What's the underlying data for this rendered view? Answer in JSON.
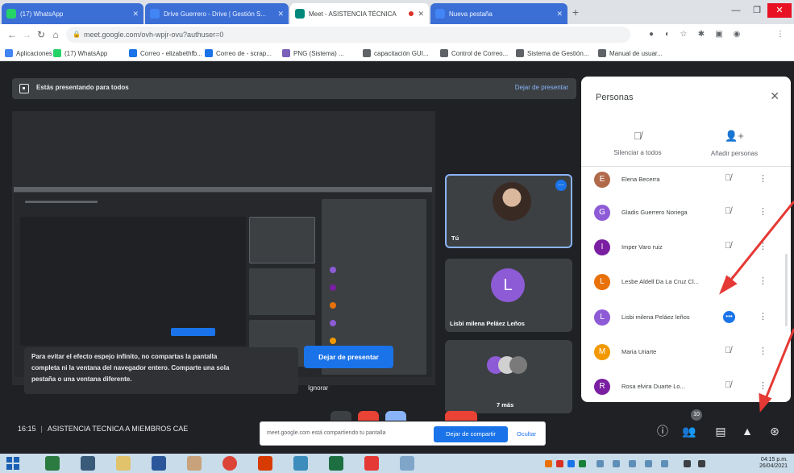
{
  "browser": {
    "tabs": [
      {
        "title": "(17) WhatsApp",
        "active": false,
        "color": "#25d366"
      },
      {
        "title": "Drive Guerrero - Drive | Gestión S...",
        "active": false,
        "color": "#4285f4"
      },
      {
        "title": "Meet - ASISTENCIA TÉCNICA",
        "active": true,
        "color": "#00897b"
      },
      {
        "title": "Nueva pestaña",
        "active": false,
        "color": "#4285f4"
      }
    ],
    "url": "meet.google.com/ovh-wpjr-ovu?authuser=0",
    "bookmarks": [
      {
        "label": "Aplicaciones",
        "color": "#4285f4"
      },
      {
        "label": "(17) WhatsApp",
        "color": "#25d366"
      },
      {
        "label": "Correo - elizabethfb...",
        "color": "#1a73e8"
      },
      {
        "label": "Correo de - scrap...",
        "color": "#1a73e8"
      },
      {
        "label": "PNG (Sistema) ...",
        "color": "#7b5fb8"
      },
      {
        "label": "capacitación GUI...",
        "color": "#5f6368"
      },
      {
        "label": "Control de Correo...",
        "color": "#5f6368"
      },
      {
        "label": "Sistema de Gestión...",
        "color": "#5f6368"
      },
      {
        "label": "Manual de usuar...",
        "color": "#5f6368"
      }
    ]
  },
  "presentation": {
    "banner_text": "Estás presentando para todos",
    "stop_link": "Dejar de presentar",
    "warning_lines": [
      "Para evitar el efecto espejo infinito, no compartas la pantalla",
      "completa ni la ventana del navegador entero. Comparte una sola",
      "pestaña o una ventana diferente."
    ],
    "stop_button": "Dejar de presentar",
    "ignore_button": "Ignorar"
  },
  "tiles": [
    {
      "label": "Tú",
      "kind": "photo"
    },
    {
      "label": "Lisbi milena Peláez Leños",
      "kind": "letter",
      "letter": "L",
      "color": "#8e5bd6"
    },
    {
      "label": "7 más",
      "kind": "group"
    }
  ],
  "people_panel": {
    "title": "Personas",
    "actions": [
      {
        "label": "Silenciar a todos",
        "icon": "mic-off-icon"
      },
      {
        "label": "Añadir personas",
        "icon": "add-person-icon"
      }
    ],
    "participants": [
      {
        "name": "Elena Becerra",
        "letter": "E",
        "color": "#b06a4a",
        "state": "muted"
      },
      {
        "name": "Gladis Guerrero Noriega",
        "letter": "G",
        "color": "#8e5bd6",
        "state": "muted"
      },
      {
        "name": "Imper Varo ruiz",
        "letter": "I",
        "color": "#7b1fa2",
        "state": "muted"
      },
      {
        "name": "Lesbe Aldell Da La Cruz Cl...",
        "letter": "L",
        "color": "#e8710a",
        "state": "muted"
      },
      {
        "name": "Lisbi milena Peláez leños",
        "letter": "L",
        "color": "#8e5bd6",
        "state": "speaking"
      },
      {
        "name": "Maria Uriarte",
        "letter": "M",
        "color": "#f29900",
        "state": "muted"
      },
      {
        "name": "Rosa elvira Duarte Lo...",
        "letter": "R",
        "color": "#7b1fa2",
        "state": "muted"
      }
    ]
  },
  "meeting": {
    "time": "16:15",
    "title": "ASISTENCIA TECNICA A MIEMBROS CAE"
  },
  "share_notice": {
    "message": "meet.google.com está compartiendo tu pantalla",
    "stop": "Dejar de compartir",
    "hide": "Ocultar"
  },
  "controls": {
    "participant_count": "10"
  },
  "taskbar": {
    "clock_time": "04:15 p.m.",
    "clock_date": "26/04/2021"
  },
  "annotations": {
    "arrow_color": "#e53935"
  }
}
